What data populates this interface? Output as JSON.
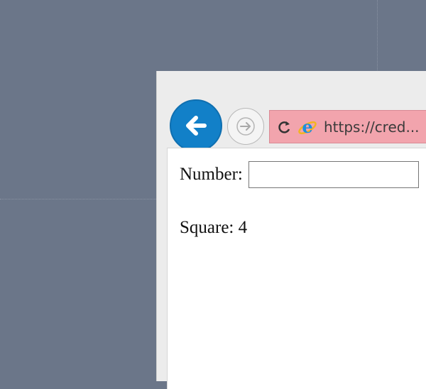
{
  "browser": {
    "url": "https://cred...",
    "nav": {
      "back_icon": "back-arrow-icon",
      "forward_icon": "forward-arrow-icon",
      "refresh_icon": "refresh-icon",
      "browser_icon": "internet-explorer-icon"
    }
  },
  "page": {
    "number_label": "Number:",
    "number_value": "",
    "square_text": "Square: 4"
  },
  "colors": {
    "desktop_background": "#6b7689",
    "back_button": "#1280c8",
    "address_bar_error": "#f2a4ad"
  }
}
